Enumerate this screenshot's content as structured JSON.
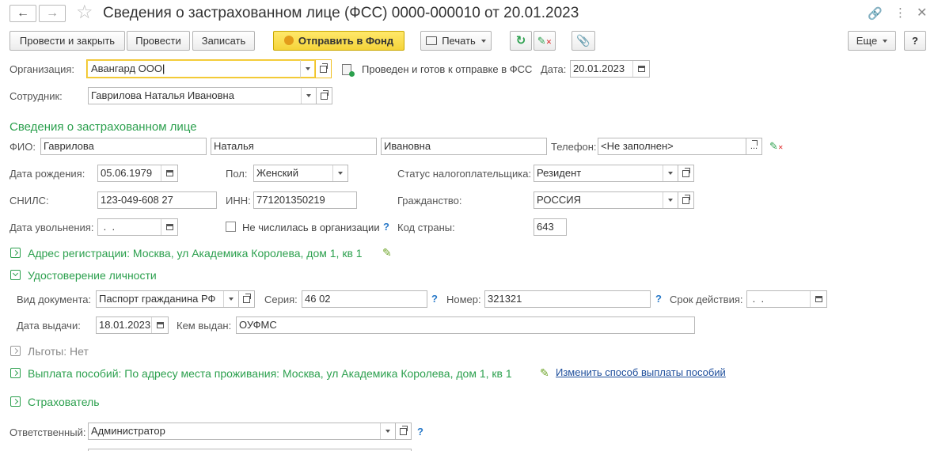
{
  "window": {
    "title": "Сведения о застрахованном лице (ФСС) 0000-000010 от 20.01.2023"
  },
  "toolbar": {
    "post_close": "Провести и закрыть",
    "post": "Провести",
    "save": "Записать",
    "send": "Отправить в Фонд",
    "print": "Печать",
    "more": "Еще",
    "help": "?"
  },
  "header": {
    "org_label": "Организация:",
    "org_value": "Авангард ООО",
    "status_text": "Проведен и готов к отправке в ФСС",
    "date_label": "Дата:",
    "date_value": "20.01.2023",
    "employee_label": "Сотрудник:",
    "employee_value": "Гаврилова Наталья Ивановна"
  },
  "insured": {
    "section_title": "Сведения о застрахованном лице",
    "fio_label": "ФИО:",
    "last_name": "Гаврилова",
    "first_name": "Наталья",
    "middle_name": "Ивановна",
    "phone_label": "Телефон:",
    "phone_value": "<Не заполнен>",
    "birth_label": "Дата рождения:",
    "birth_value": "05.06.1979",
    "sex_label": "Пол:",
    "sex_value": "Женский",
    "tax_status_label": "Статус налогоплательщика:",
    "tax_status_value": "Резидент",
    "snils_label": "СНИЛС:",
    "snils_value": "123-049-608 27",
    "inn_label": "ИНН:",
    "inn_value": "771201350219",
    "citizenship_label": "Гражданство:",
    "citizenship_value": "РОССИЯ",
    "dismiss_label": "Дата увольнения:",
    "dismiss_value": " .  .",
    "not_listed_label": "Не числилась в организации",
    "not_listed_checked": false,
    "country_code_label": "Код страны:",
    "country_code_value": "643"
  },
  "address": {
    "title": "Адрес регистрации: Москва, ул Академика Королева, дом 1, кв 1"
  },
  "identity": {
    "title": "Удостоверение личности",
    "doc_type_label": "Вид документа:",
    "doc_type_value": "Паспорт гражданина РФ",
    "series_label": "Серия:",
    "series_value": "46 02",
    "number_label": "Номер:",
    "number_value": "321321",
    "validity_label": "Срок действия:",
    "validity_value": " .  .",
    "issue_date_label": "Дата выдачи:",
    "issue_date_value": "18.01.2023",
    "issued_by_label": "Кем выдан:",
    "issued_by_value": "ОУФМС"
  },
  "benefits": {
    "title": "Льготы: Нет"
  },
  "payment": {
    "title": "Выплата пособий: По адресу места проживания: Москва, ул Академика Королева, дом 1, кв 1",
    "change_link": "Изменить способ выплаты пособий"
  },
  "insurer": {
    "title": "Страхователь",
    "responsible_label": "Ответственный:",
    "responsible_value": "Администратор"
  },
  "colors": {
    "accent_green": "#2ca04e",
    "send_button": "#f5d43a",
    "link_blue": "#1f4f9c"
  }
}
